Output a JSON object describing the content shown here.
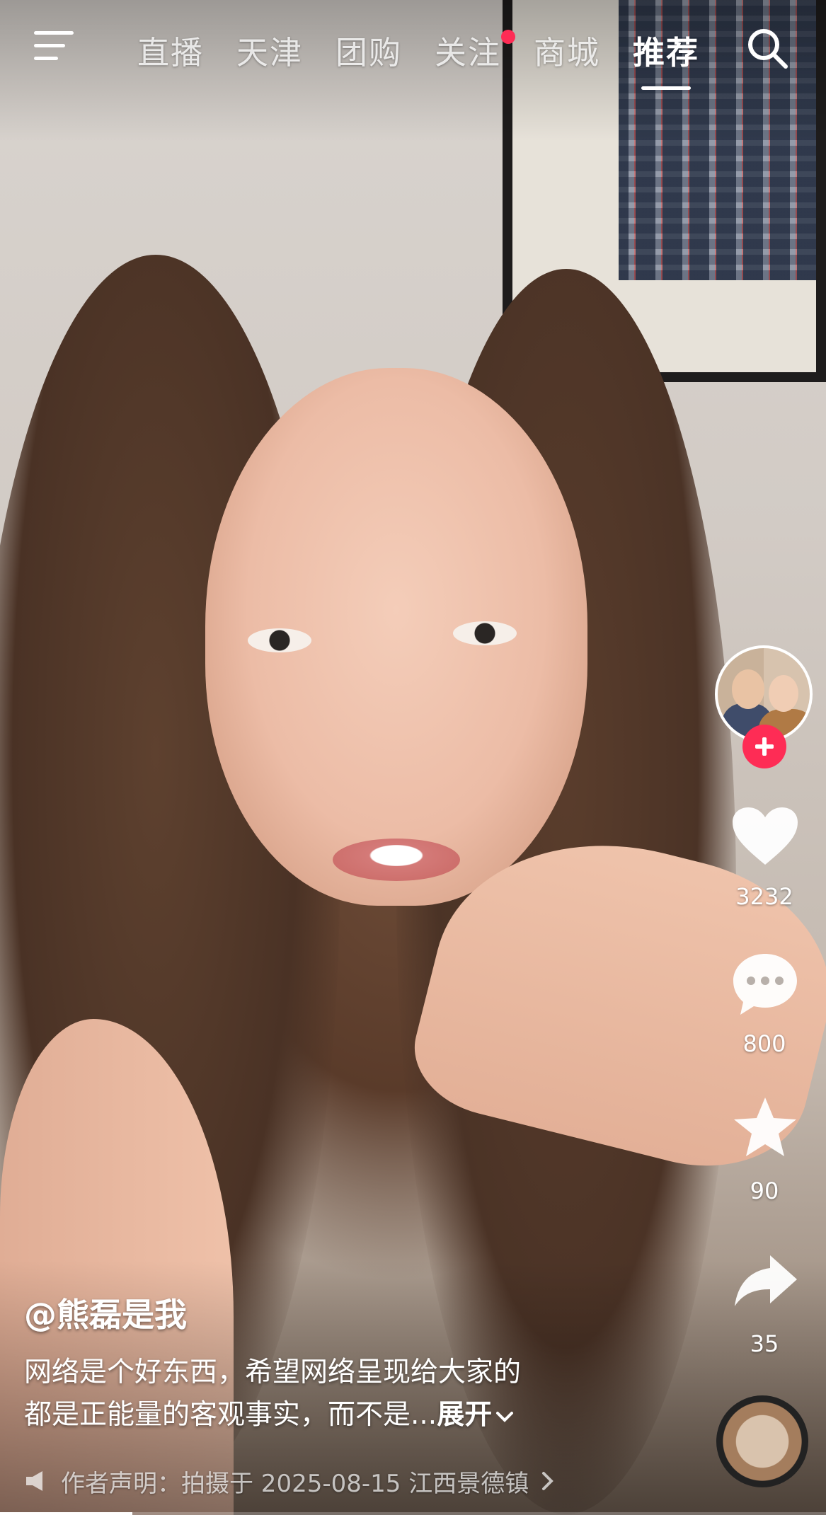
{
  "nav": {
    "tabs": [
      "直播",
      "天津",
      "团购",
      "关注",
      "商城",
      "推荐"
    ],
    "active_tab": "推荐",
    "icons": {
      "menu": "menu-icon",
      "search": "search-icon"
    },
    "notification_dot_on": "关注",
    "dot_color": "#fe2c55"
  },
  "rail": {
    "likes": "3232",
    "comments": "800",
    "favorites": "90",
    "shares": "35",
    "follow_color": "#fe2c55"
  },
  "video": {
    "author": "@熊磊是我",
    "description_line1": "网络是个好东西，希望网络呈现给大家的",
    "description_line2": "都是正能量的客观事实，而不是...",
    "expand_label": "展开",
    "declaration": "作者声明：拍摄于 2025-08-15 江西景德镇",
    "progress": 0.16
  }
}
